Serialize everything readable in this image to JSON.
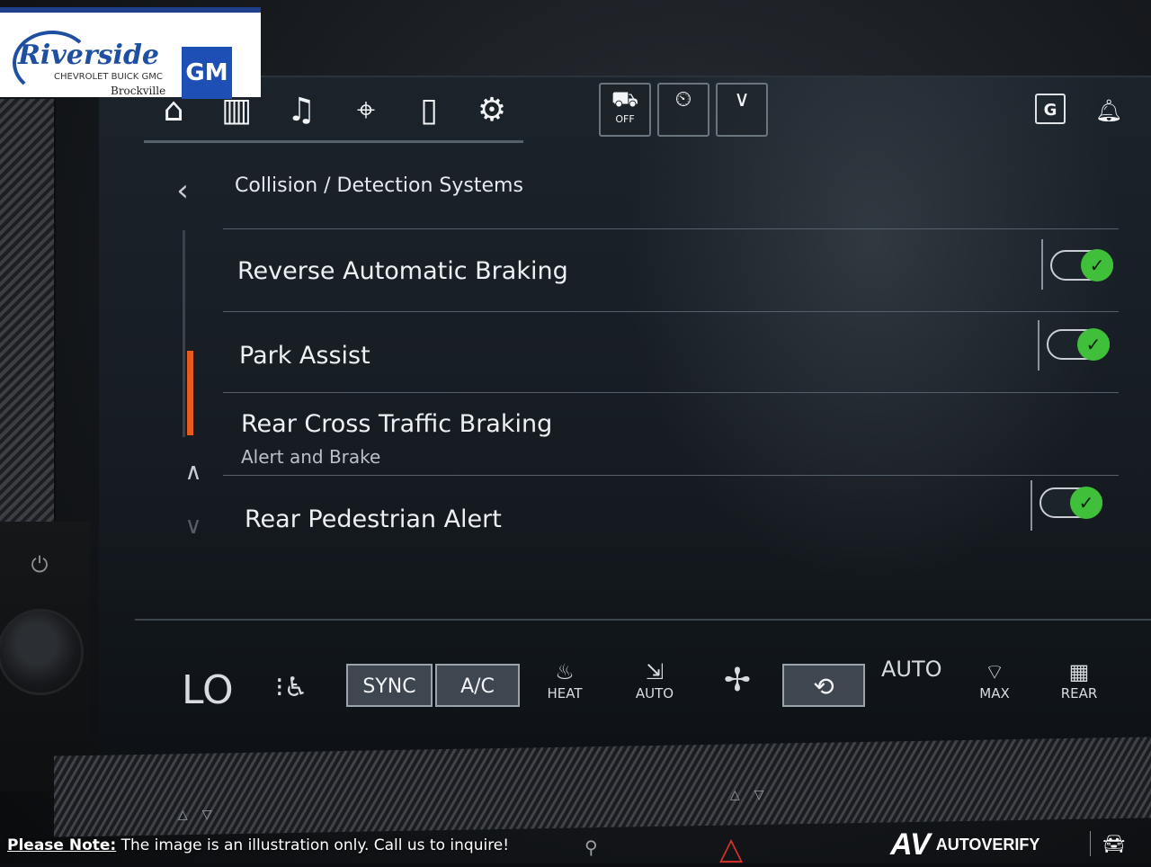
{
  "dealer": {
    "brand": "Riverside",
    "brands_small": "CHEVROLET  BUICK  GMC",
    "city": "Brockville",
    "badge": "GM"
  },
  "nav": {
    "icons": [
      "home-icon",
      "apps-grid-icon",
      "music-note-icon",
      "map-pin-icon",
      "phone-icon",
      "settings-toggles-icon"
    ],
    "quick_buttons": [
      {
        "icon": "traction-off-icon",
        "label": "OFF"
      },
      {
        "icon": "vehicle-history-icon",
        "label": ""
      },
      {
        "icon": "chevron-down-icon",
        "label": ""
      }
    ],
    "profile_badge": "G",
    "notification_icon": "bell-icon"
  },
  "header": {
    "back_icon": "back-arrow-icon",
    "title": "Collision / Detection Systems"
  },
  "settings": [
    {
      "label": "Reverse Automatic Braking",
      "sublabel": "",
      "toggle": true
    },
    {
      "label": "Park Assist",
      "sublabel": "",
      "toggle": true
    },
    {
      "label": "Rear Cross Traffic Braking",
      "sublabel": "Alert and Brake",
      "toggle": null
    },
    {
      "label": "Rear Pedestrian Alert",
      "sublabel": "",
      "toggle": true
    }
  ],
  "scroll": {
    "thumb_color": "#e85a1e"
  },
  "climate": {
    "temperature": "LO",
    "sync_label": "SYNC",
    "ac_label": "A/C",
    "heat_label": "HEAT",
    "auto_fan_label": "AUTO",
    "auto_text": "AUTO",
    "max_label": "MAX",
    "rear_label": "REAR"
  },
  "footer": {
    "note_key": "Please Note:",
    "note_text": " The image is an illustration only. Call us to inquire!",
    "watermark": "AUTOVERIFY",
    "watermark_mark": "AV"
  },
  "colors": {
    "toggle_on": "#3fbf3a",
    "accent_orange": "#e85a1e",
    "gm_blue": "#1e4fb4"
  }
}
